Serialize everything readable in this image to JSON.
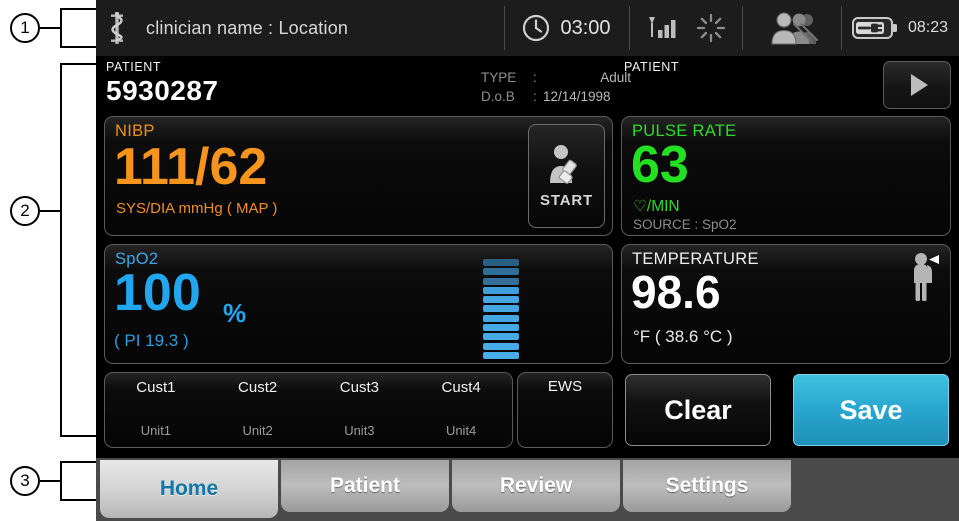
{
  "callouts": [
    {
      "number": "1"
    },
    {
      "number": "2"
    },
    {
      "number": "3"
    }
  ],
  "header": {
    "caduceus_icon": "caduceus-icon",
    "clinician_text": "clinician name : Location",
    "clock_icon": "clock-icon",
    "timer": "03:00",
    "signal_icon": "wifi-signal-icon",
    "spinner_icon": "spinner-icon",
    "patients_icon": "patients-icon",
    "battery_icon": "battery-charging-icon",
    "battery_time": "08:23"
  },
  "patient": {
    "label_left": "PATIENT",
    "id": "5930287",
    "type_key": "TYPE",
    "type_sep": ":",
    "type_value": "Adult",
    "dob_key": "D.o.B",
    "dob_sep": ":",
    "dob_value": "12/14/1998",
    "label_right": "PATIENT",
    "play_icon": "play-icon"
  },
  "nibp": {
    "title": "NIBP",
    "value": "111/62",
    "units": "SYS/DIA mmHg ( MAP )",
    "start_label": "START",
    "start_icon": "nibp-cuff-person-icon",
    "color": "#f7941d"
  },
  "pulse": {
    "title": "PULSE RATE",
    "value": "63",
    "units": "♡/MIN",
    "source": "SOURCE : SpO2",
    "color": "#22e022"
  },
  "spo2": {
    "title": "SpO2",
    "value": "100",
    "percent": "%",
    "pi": "( PI 19.3 )",
    "color": "#21a7f0",
    "pleth_segments": [
      "#2a5f84",
      "#2f6e96",
      "#336f97",
      "#3f9fdc",
      "#44a6e2",
      "#44a6e2",
      "#44a6e2",
      "#45a9e6",
      "#45a9e6",
      "#46abe8",
      "#47ade9"
    ]
  },
  "temperature": {
    "title": "TEMPERATURE",
    "value": "98.6",
    "units": "°F  ( 38.6 °C )",
    "icon": "temperature-person-icon",
    "color": "#ffffff"
  },
  "custom_fields": [
    {
      "name": "Cust1",
      "unit": "Unit1"
    },
    {
      "name": "Cust2",
      "unit": "Unit2"
    },
    {
      "name": "Cust3",
      "unit": "Unit3"
    },
    {
      "name": "Cust4",
      "unit": "Unit4"
    }
  ],
  "ews": {
    "label": "EWS",
    "value": ""
  },
  "actions": {
    "clear_label": "Clear",
    "save_label": "Save",
    "save_color": "#29a9d0"
  },
  "tabs": [
    {
      "label": "Home",
      "active": true
    },
    {
      "label": "Patient",
      "active": false
    },
    {
      "label": "Review",
      "active": false
    },
    {
      "label": "Settings",
      "active": false
    }
  ]
}
